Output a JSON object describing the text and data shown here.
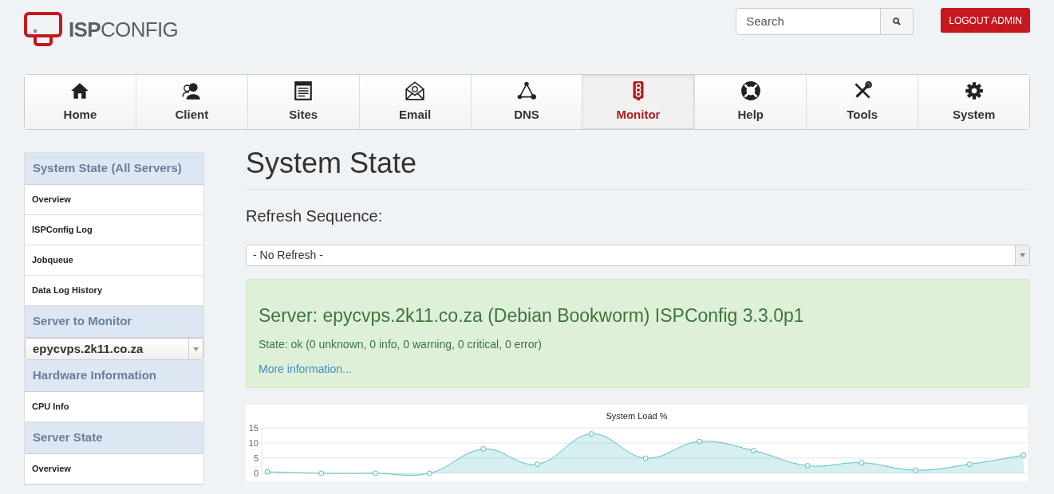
{
  "logo": {
    "strong": "ISP",
    "light": "CONFIG"
  },
  "search": {
    "placeholder": "Search"
  },
  "logout_button": "LOGOUT ADMIN",
  "tabs": [
    {
      "label": "Home",
      "selected": false
    },
    {
      "label": "Client",
      "selected": false
    },
    {
      "label": "Sites",
      "selected": false
    },
    {
      "label": "Email",
      "selected": false
    },
    {
      "label": "DNS",
      "selected": false
    },
    {
      "label": "Monitor",
      "selected": true
    },
    {
      "label": "Help",
      "selected": false
    },
    {
      "label": "Tools",
      "selected": false
    },
    {
      "label": "System",
      "selected": false
    }
  ],
  "sidebar": {
    "sections": [
      {
        "title": "System State (All Servers)",
        "items": [
          {
            "label": "Overview",
            "selected": false
          },
          {
            "label": "ISPConfig Log",
            "selected": false
          },
          {
            "label": "Jobqueue",
            "selected": false
          },
          {
            "label": "Data Log History",
            "selected": false
          }
        ]
      },
      {
        "title": "Server to Monitor",
        "select": {
          "value": "epycvps.2k11.co.za"
        }
      },
      {
        "title": "Hardware Information",
        "items": [
          {
            "label": "CPU Info",
            "selected": false
          }
        ]
      },
      {
        "title": "Server State",
        "items": [
          {
            "label": "Overview",
            "selected": false
          }
        ]
      }
    ]
  },
  "page_title": "System State",
  "refresh": {
    "label": "Refresh Sequence:",
    "value": "- No Refresh -"
  },
  "status_panel": {
    "title": "Server: epycvps.2k11.co.za (Debian Bookworm) ISPConfig 3.3.0p1",
    "state": "State: ok (0 unknown, 0 info, 0 warning, 0 critical, 0 error)",
    "link": "More information..."
  },
  "chart_data": {
    "type": "area",
    "title": "System Load %",
    "series": [
      {
        "color": "#5bc0c8",
        "values": [
          0.5,
          0,
          0,
          0,
          8,
          3,
          13,
          5,
          10.5,
          7.5,
          2.5,
          3.5,
          1,
          3,
          6
        ]
      }
    ],
    "ylim": [
      0,
      15
    ],
    "yticks": [
      0,
      5,
      10,
      15
    ]
  }
}
